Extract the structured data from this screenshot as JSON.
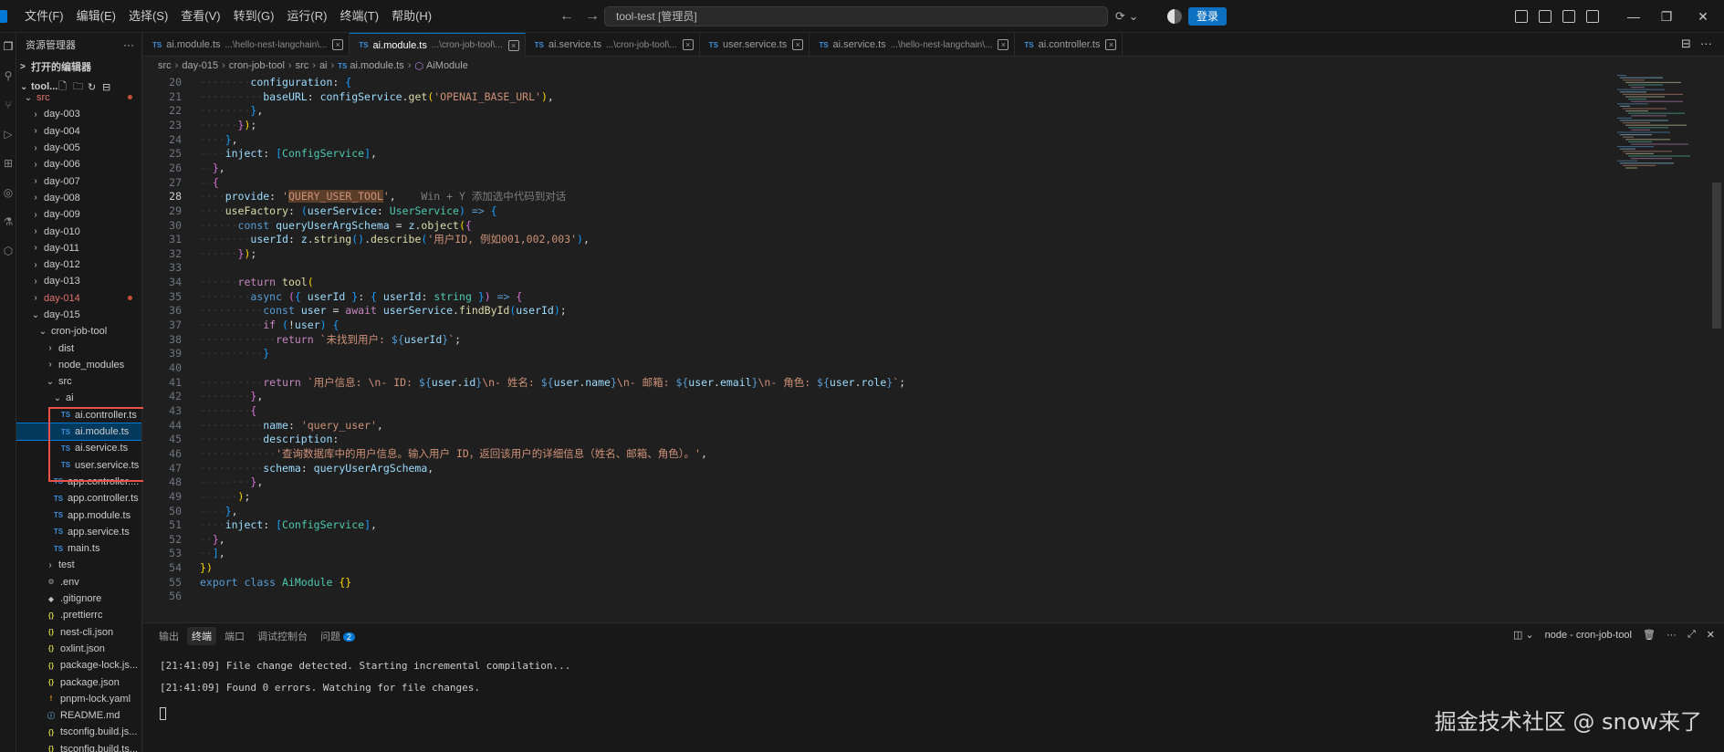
{
  "menu": [
    "文件(F)",
    "编辑(E)",
    "选择(S)",
    "查看(V)",
    "转到(G)",
    "运行(R)",
    "终端(T)",
    "帮助(H)"
  ],
  "title": {
    "command_center": "tool-test [管理员]",
    "login": "登录"
  },
  "explorer": {
    "title": "资源管理器",
    "open_editors": "打开的编辑器",
    "root": "tool...",
    "tree": [
      {
        "label": "src",
        "indent": 0,
        "kind": "folder-open",
        "modified": true,
        "dot": true
      },
      {
        "label": "day-003",
        "indent": 1,
        "kind": "folder"
      },
      {
        "label": "day-004",
        "indent": 1,
        "kind": "folder"
      },
      {
        "label": "day-005",
        "indent": 1,
        "kind": "folder"
      },
      {
        "label": "day-006",
        "indent": 1,
        "kind": "folder"
      },
      {
        "label": "day-007",
        "indent": 1,
        "kind": "folder"
      },
      {
        "label": "day-008",
        "indent": 1,
        "kind": "folder"
      },
      {
        "label": "day-009",
        "indent": 1,
        "kind": "folder"
      },
      {
        "label": "day-010",
        "indent": 1,
        "kind": "folder"
      },
      {
        "label": "day-011",
        "indent": 1,
        "kind": "folder"
      },
      {
        "label": "day-012",
        "indent": 1,
        "kind": "folder"
      },
      {
        "label": "day-013",
        "indent": 1,
        "kind": "folder"
      },
      {
        "label": "day-014",
        "indent": 1,
        "kind": "folder",
        "modified": true,
        "dot": true
      },
      {
        "label": "day-015",
        "indent": 1,
        "kind": "folder-open"
      },
      {
        "label": "cron-job-tool",
        "indent": 2,
        "kind": "folder-open"
      },
      {
        "label": "dist",
        "indent": 3,
        "kind": "folder"
      },
      {
        "label": "node_modules",
        "indent": 3,
        "kind": "folder"
      },
      {
        "label": "src",
        "indent": 3,
        "kind": "folder-open"
      },
      {
        "label": "ai",
        "indent": 4,
        "kind": "folder-open"
      },
      {
        "label": "ai.controller.ts",
        "indent": 5,
        "kind": "ts"
      },
      {
        "label": "ai.module.ts",
        "indent": 5,
        "kind": "ts",
        "selected": true
      },
      {
        "label": "ai.service.ts",
        "indent": 5,
        "kind": "ts"
      },
      {
        "label": "user.service.ts",
        "indent": 5,
        "kind": "ts"
      },
      {
        "label": "app.controller....",
        "indent": 4,
        "kind": "ts"
      },
      {
        "label": "app.controller.ts",
        "indent": 4,
        "kind": "ts"
      },
      {
        "label": "app.module.ts",
        "indent": 4,
        "kind": "ts"
      },
      {
        "label": "app.service.ts",
        "indent": 4,
        "kind": "ts"
      },
      {
        "label": "main.ts",
        "indent": 4,
        "kind": "ts"
      },
      {
        "label": "test",
        "indent": 3,
        "kind": "folder"
      },
      {
        "label": ".env",
        "indent": 3,
        "kind": "gear"
      },
      {
        "label": ".gitignore",
        "indent": 3,
        "kind": "git"
      },
      {
        "label": ".prettierrc",
        "indent": 3,
        "kind": "json"
      },
      {
        "label": "nest-cli.json",
        "indent": 3,
        "kind": "json"
      },
      {
        "label": "oxlint.json",
        "indent": 3,
        "kind": "json"
      },
      {
        "label": "package-lock.js...",
        "indent": 3,
        "kind": "json"
      },
      {
        "label": "package.json",
        "indent": 3,
        "kind": "json"
      },
      {
        "label": "pnpm-lock.yaml",
        "indent": 3,
        "kind": "pnpm"
      },
      {
        "label": "README.md",
        "indent": 3,
        "kind": "info"
      },
      {
        "label": "tsconfig.build.js...",
        "indent": 3,
        "kind": "json"
      },
      {
        "label": "tsconfig.build.ts...",
        "indent": 3,
        "kind": "json"
      }
    ]
  },
  "tabs": [
    {
      "label": "ai.module.ts",
      "desc": "...\\hello-nest-langchain\\...",
      "active": false
    },
    {
      "label": "ai.module.ts",
      "desc": "...\\cron-job-tool\\...",
      "active": true
    },
    {
      "label": "ai.service.ts",
      "desc": "...\\cron-job-tool\\...",
      "active": false
    },
    {
      "label": "user.service.ts",
      "desc": "",
      "active": false
    },
    {
      "label": "ai.service.ts",
      "desc": "...\\hello-nest-langchain\\...",
      "active": false
    },
    {
      "label": "ai.controller.ts",
      "desc": "",
      "active": false
    }
  ],
  "breadcrumb": [
    "src",
    "day-015",
    "cron-job-tool",
    "src",
    "ai",
    "ai.module.ts",
    "AiModule"
  ],
  "editor": {
    "current_line": 28,
    "lines": [
      {
        "n": 20,
        "indent": 4,
        "code": "<span class=\"p\">configuration</span><span class=\"o\">: </span><span class=\"b3\">{</span>"
      },
      {
        "n": 21,
        "indent": 5,
        "code": "<span class=\"p\">baseURL</span><span class=\"o\">: </span><span class=\"p\">configService</span><span class=\"o\">.</span><span class=\"f\">get</span><span class=\"b\">(</span><span class=\"s\">'OPENAI_BASE_URL'</span><span class=\"b\">)</span><span class=\"o\">,</span>"
      },
      {
        "n": 22,
        "indent": 4,
        "code": "<span class=\"b3\">}</span><span class=\"o\">,</span>"
      },
      {
        "n": 23,
        "indent": 3,
        "code": "<span class=\"b2\">}</span><span class=\"b\">)</span><span class=\"o\">;</span>"
      },
      {
        "n": 24,
        "indent": 2,
        "code": "<span class=\"b3\">}</span><span class=\"o\">,</span>"
      },
      {
        "n": 25,
        "indent": 2,
        "code": "<span class=\"p\">inject</span><span class=\"o\">: </span><span class=\"b3\">[</span><span class=\"t\">ConfigService</span><span class=\"b3\">]</span><span class=\"o\">,</span>"
      },
      {
        "n": 26,
        "indent": 1,
        "code": "<span class=\"b2\">}</span><span class=\"o\">,</span>"
      },
      {
        "n": 27,
        "indent": 1,
        "code": "<span class=\"b2\">{</span>"
      },
      {
        "n": 28,
        "indent": 2,
        "code": "<span class=\"p\">provide</span><span class=\"o\">: </span><span class=\"s\">'<span class=\"hl\">QUERY_USER_TOOL</span>'</span><span class=\"o\">,</span><span class=\"hint\">    Win + Y 添加选中代码到对话</span>"
      },
      {
        "n": 29,
        "indent": 2,
        "code": "<span class=\"f\">useFactory</span><span class=\"o\">: </span><span class=\"b3\">(</span><span class=\"p\">userService</span><span class=\"o\">: </span><span class=\"t\">UserService</span><span class=\"b3\">)</span><span class=\"o\"> </span><span class=\"k\">=&gt;</span><span class=\"o\"> </span><span class=\"b3\">{</span>"
      },
      {
        "n": 30,
        "indent": 3,
        "code": "<span class=\"k\">const</span><span class=\"o\"> </span><span class=\"p\">queryUserArgSchema</span><span class=\"o\"> = </span><span class=\"p\">z</span><span class=\"o\">.</span><span class=\"f\">object</span><span class=\"b\">(</span><span class=\"b2\">{</span>"
      },
      {
        "n": 31,
        "indent": 4,
        "code": "<span class=\"p\">userId</span><span class=\"o\">: </span><span class=\"p\">z</span><span class=\"o\">.</span><span class=\"f\">string</span><span class=\"b3\">()</span><span class=\"o\">.</span><span class=\"f\">describe</span><span class=\"b3\">(</span><span class=\"s\">'用户ID, 例如001,002,003'</span><span class=\"b3\">)</span><span class=\"o\">,</span>"
      },
      {
        "n": 32,
        "indent": 3,
        "code": "<span class=\"b2\">}</span><span class=\"b\">)</span><span class=\"o\">;</span>"
      },
      {
        "n": 33,
        "indent": 0,
        "code": ""
      },
      {
        "n": 34,
        "indent": 3,
        "code": "<span class=\"kc\">return</span><span class=\"o\"> </span><span class=\"f\">tool</span><span class=\"b\">(</span>"
      },
      {
        "n": 35,
        "indent": 4,
        "code": "<span class=\"k\">async</span><span class=\"o\"> </span><span class=\"b2\">(</span><span class=\"b3\">{</span><span class=\"o\"> </span><span class=\"p\">userId</span><span class=\"o\"> </span><span class=\"b3\">}</span><span class=\"o\">: </span><span class=\"b3\">{</span><span class=\"o\"> </span><span class=\"p\">userId</span><span class=\"o\">: </span><span class=\"t\">string</span><span class=\"o\"> </span><span class=\"b3\">}</span><span class=\"b2\">)</span><span class=\"o\"> </span><span class=\"k\">=&gt;</span><span class=\"o\"> </span><span class=\"b2\">{</span>"
      },
      {
        "n": 36,
        "indent": 5,
        "code": "<span class=\"k\">const</span><span class=\"o\"> </span><span class=\"p\">user</span><span class=\"o\"> = </span><span class=\"kc\">await</span><span class=\"o\"> </span><span class=\"p\">userService</span><span class=\"o\">.</span><span class=\"f\">findById</span><span class=\"b3\">(</span><span class=\"p\">userId</span><span class=\"b3\">)</span><span class=\"o\">;</span>"
      },
      {
        "n": 37,
        "indent": 5,
        "code": "<span class=\"kc\">if</span><span class=\"o\"> </span><span class=\"b3\">(</span><span class=\"o\">!</span><span class=\"p\">user</span><span class=\"b3\">)</span><span class=\"o\"> </span><span class=\"b3\">{</span>"
      },
      {
        "n": 38,
        "indent": 6,
        "code": "<span class=\"kc\">return</span><span class=\"o\"> </span><span class=\"s\">`未找到用户: </span><span class=\"k\">${</span><span class=\"p\">userId</span><span class=\"k\">}</span><span class=\"s\">`</span><span class=\"o\">;</span>"
      },
      {
        "n": 39,
        "indent": 5,
        "code": "<span class=\"b3\">}</span>"
      },
      {
        "n": 40,
        "indent": 0,
        "code": ""
      },
      {
        "n": 41,
        "indent": 5,
        "code": "<span class=\"kc\">return</span><span class=\"o\"> </span><span class=\"s\">`用户信息: \\n- ID: </span><span class=\"k\">${</span><span class=\"p\">user</span><span class=\"o\">.</span><span class=\"p\">id</span><span class=\"k\">}</span><span class=\"s\">\\n- 姓名: </span><span class=\"k\">${</span><span class=\"p\">user</span><span class=\"o\">.</span><span class=\"p\">name</span><span class=\"k\">}</span><span class=\"s\">\\n- 邮箱: </span><span class=\"k\">${</span><span class=\"p\">user</span><span class=\"o\">.</span><span class=\"p\">email</span><span class=\"k\">}</span><span class=\"s\">\\n- 角色: </span><span class=\"k\">${</span><span class=\"p\">user</span><span class=\"o\">.</span><span class=\"p\">role</span><span class=\"k\">}</span><span class=\"s\">`</span><span class=\"o\">;</span>"
      },
      {
        "n": 42,
        "indent": 4,
        "code": "<span class=\"b2\">}</span><span class=\"o\">,</span>"
      },
      {
        "n": 43,
        "indent": 4,
        "code": "<span class=\"b2\">{</span>"
      },
      {
        "n": 44,
        "indent": 5,
        "code": "<span class=\"p\">name</span><span class=\"o\">: </span><span class=\"s\">'query_user'</span><span class=\"o\">,</span>"
      },
      {
        "n": 45,
        "indent": 5,
        "code": "<span class=\"p\">description</span><span class=\"o\">:</span>"
      },
      {
        "n": 46,
        "indent": 6,
        "code": "<span class=\"s\">'查询数据库中的用户信息。输入用户 ID，返回该用户的详细信息（姓名、邮箱、角色）。'</span><span class=\"o\">,</span>"
      },
      {
        "n": 47,
        "indent": 5,
        "code": "<span class=\"p\">schema</span><span class=\"o\">: </span><span class=\"p\">queryUserArgSchema</span><span class=\"o\">,</span>"
      },
      {
        "n": 48,
        "indent": 4,
        "code": "<span class=\"b2\">}</span><span class=\"o\">,</span>"
      },
      {
        "n": 49,
        "indent": 3,
        "code": "<span class=\"b\">)</span><span class=\"o\">;</span>"
      },
      {
        "n": 50,
        "indent": 2,
        "code": "<span class=\"b3\">}</span><span class=\"o\">,</span>"
      },
      {
        "n": 51,
        "indent": 2,
        "code": "<span class=\"p\">inject</span><span class=\"o\">: </span><span class=\"b3\">[</span><span class=\"t\">ConfigService</span><span class=\"b3\">]</span><span class=\"o\">,</span>"
      },
      {
        "n": 52,
        "indent": 1,
        "code": "<span class=\"b2\">}</span><span class=\"o\">,</span>"
      },
      {
        "n": 53,
        "indent": 1,
        "code": "<span class=\"b3\">]</span><span class=\"o\">,</span>"
      },
      {
        "n": 54,
        "indent": 0,
        "code": "<span class=\"b\">}</span><span class=\"b\">)</span>"
      },
      {
        "n": 55,
        "indent": 0,
        "code": "<span class=\"k\">export</span><span class=\"o\"> </span><span class=\"k\">class</span><span class=\"o\"> </span><span class=\"t\">AiModule</span><span class=\"o\"> </span><span class=\"b\">{}</span>"
      },
      {
        "n": 56,
        "indent": 0,
        "code": ""
      }
    ]
  },
  "panel": {
    "tabs": [
      "输出",
      "终端",
      "端口",
      "调试控制台",
      "问题"
    ],
    "active_tab": "终端",
    "problems_count": "2",
    "terminal_name": "node - cron-job-tool",
    "lines": [
      "[21:41:09] File change detected. Starting incremental compilation...",
      "[21:41:09] Found 0 errors. Watching for file changes."
    ]
  },
  "watermark": "掘金技术社区 @ snow来了"
}
